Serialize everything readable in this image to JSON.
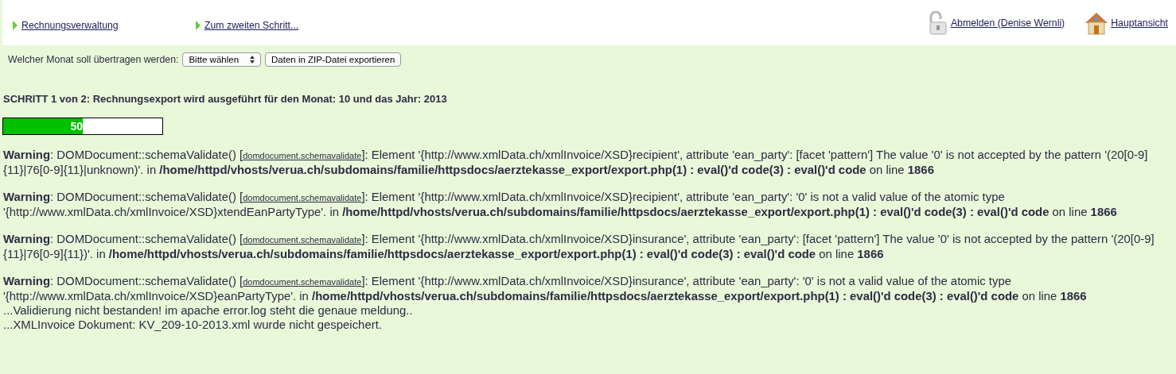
{
  "nav": {
    "links": [
      {
        "label": "Rechnungsverwaltung"
      },
      {
        "label": "Zum zweiten Schritt..."
      }
    ],
    "logout": "Abmelden (Denise Wernli)",
    "home": "Hauptansicht"
  },
  "form": {
    "label": "Welcher Monat soll übertragen werden:",
    "select": "Bitte wählen",
    "button": "Daten in ZIP-Datei exportieren"
  },
  "heading": "SCHRITT 1 von 2: Rechnungsexport wird ausgeführt für den Monat: 10 und das Jahr: 2013",
  "progress": {
    "level": 0.5,
    "reading": "50"
  },
  "warnings": [
    {
      "before": "**Warning**: DOMDocument::schemaValidate() [",
      "link": "domdocument.schemavalidate",
      "after": "]: Element '{http://www.xmlData.ch/xmlInvoice/XSD}recipient', attribute 'ean_party': [facet 'pattern'] The value '0' is not accepted by the pattern '(20[0-9]{11}|76[0-9]{11}|unknown)'. in **/home/httpd/vhosts/verua.ch/subdomains/familie/httpsdocs/aerztekasse_export/export.php(1) : eval()'d code(3) : eval()'d code** on line **1866**"
    },
    {
      "before": "**Warning**: DOMDocument::schemaValidate() [",
      "link": "domdocument.schemavalidate",
      "after": "]: Element '{http://www.xmlData.ch/xmlInvoice/XSD}recipient', attribute 'ean_party': '0' is not a valid value of the atomic type '{http://www.xmlData.ch/xmlInvoice/XSD}xtendEanPartyType'. in **/home/httpd/vhosts/verua.ch/subdomains/familie/httpsdocs/aerztekasse_export/export.php(1) : eval()'d code(3) : eval()'d code** on line **1866**"
    },
    {
      "before": "**Warning**: DOMDocument::schemaValidate() [",
      "link": "domdocument.schemavalidate",
      "after": "]: Element '{http://www.xmlData.ch/xmlInvoice/XSD}insurance', attribute 'ean_party': [facet 'pattern'] The value '0' is not accepted by the pattern '(20[0-9]{11}|76[0-9]{11})'. in **/home/httpd/vhosts/verua.ch/subdomains/familie/httpsdocs/aerztekasse_export/export.php(1) : eval()'d code(3) : eval()'d code** on line **1866**"
    },
    {
      "before": "**Warning**: DOMDocument::schemaValidate() [",
      "link": "domdocument.schemavalidate",
      "after": "]: Element '{http://www.xmlData.ch/xmlInvoice/XSD}insurance', attribute 'ean_party': '0' is not a valid value of the atomic type '{http://www.xmlData.ch/xmlInvoice/XSD}eanPartyType'. in **/home/httpd/vhosts/verua.ch/subdomains/familie/httpsdocs/aerztekasse_export/export.php(1) : eval()'d code(3) : eval()'d code** on line **1866**"
    }
  ],
  "messages": [
    "...Validierung nicht bestanden! im apache error.log steht die genaue meldung..",
    "...XMLInvoice Dokument: KV_209-10-2013.xml wurde nicht gespeichert."
  ]
}
